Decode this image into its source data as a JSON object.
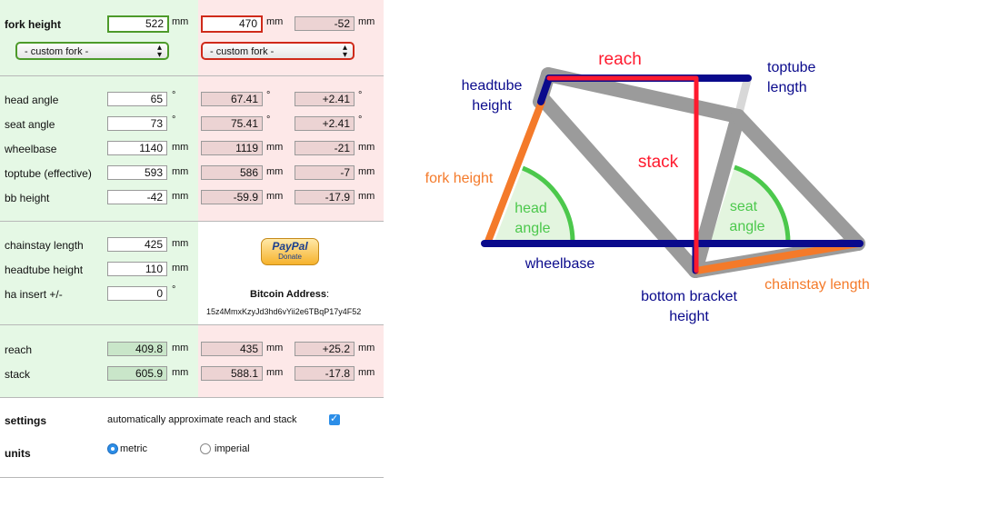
{
  "fork_height": {
    "label": "fork height",
    "value": "522",
    "unit": "mm",
    "alt_value": "470",
    "alt_unit": "mm",
    "diff": "-52",
    "diff_unit": "mm"
  },
  "fork_select": {
    "left": "- custom fork -",
    "right": "- custom fork -"
  },
  "angles": [
    {
      "label": "head angle",
      "value": "65",
      "unit": "°",
      "alt": "67.41",
      "alt_unit": "°",
      "diff": "+2.41",
      "diff_unit": "°"
    },
    {
      "label": "seat angle",
      "value": "73",
      "unit": "°",
      "alt": "75.41",
      "alt_unit": "°",
      "diff": "+2.41",
      "diff_unit": "°"
    },
    {
      "label": "wheelbase",
      "value": "1140",
      "unit": "mm",
      "alt": "1119",
      "alt_unit": "mm",
      "diff": "-21",
      "diff_unit": "mm"
    },
    {
      "label": "toptube (effective)",
      "value": "593",
      "unit": "mm",
      "alt": "586",
      "alt_unit": "mm",
      "diff": "-7",
      "diff_unit": "mm"
    },
    {
      "label": "bb height",
      "value": "-42",
      "unit": "mm",
      "alt": "-59.9",
      "alt_unit": "mm",
      "diff": "-17.9",
      "diff_unit": "mm"
    }
  ],
  "frame": [
    {
      "label": "chainstay length",
      "value": "425",
      "unit": "mm"
    },
    {
      "label": "headtube height",
      "value": "110",
      "unit": "mm"
    },
    {
      "label": "ha insert +/-",
      "value": "0",
      "unit": "°"
    }
  ],
  "donate": {
    "paypal": "PayPal",
    "donate": "Donate",
    "bitcoin_label": "Bitcoin Address",
    "bitcoin_colon": ":",
    "bitcoin_address": "15z4MmxKzyJd3hd6vYii2e6TBqP17y4F52"
  },
  "results": [
    {
      "label": "reach",
      "value": "409.8",
      "unit": "mm",
      "alt": "435",
      "alt_unit": "mm",
      "diff": "+25.2",
      "diff_unit": "mm"
    },
    {
      "label": "stack",
      "value": "605.9",
      "unit": "mm",
      "alt": "588.1",
      "alt_unit": "mm",
      "diff": "-17.8",
      "diff_unit": "mm"
    }
  ],
  "settings": {
    "label": "settings",
    "checkbox_label": "automatically approximate reach and stack",
    "checked": true
  },
  "units": {
    "label": "units",
    "metric": "metric",
    "imperial": "imperial",
    "selected": "metric"
  },
  "diagram": {
    "reach": "reach",
    "toptube_1": "toptube",
    "toptube_2": "length",
    "headtube_1": "headtube",
    "headtube_2": "height",
    "stack": "stack",
    "fork_height": "fork height",
    "head_angle_1": "head",
    "head_angle_2": "angle",
    "seat_angle_1": "seat",
    "seat_angle_2": "angle",
    "wheelbase": "wheelbase",
    "bb_1": "bottom bracket",
    "bb_2": "height",
    "chainstay": "chainstay length"
  },
  "colors": {
    "blue": "#0a0a8c",
    "red": "#ff1a2e",
    "orange": "#f47a2a",
    "grey": "#9b9b9b",
    "green": "#4cc84c",
    "green_fill": "#e3f5df",
    "panel_green": "#e5f8e5",
    "panel_pink": "#fde8e8"
  }
}
